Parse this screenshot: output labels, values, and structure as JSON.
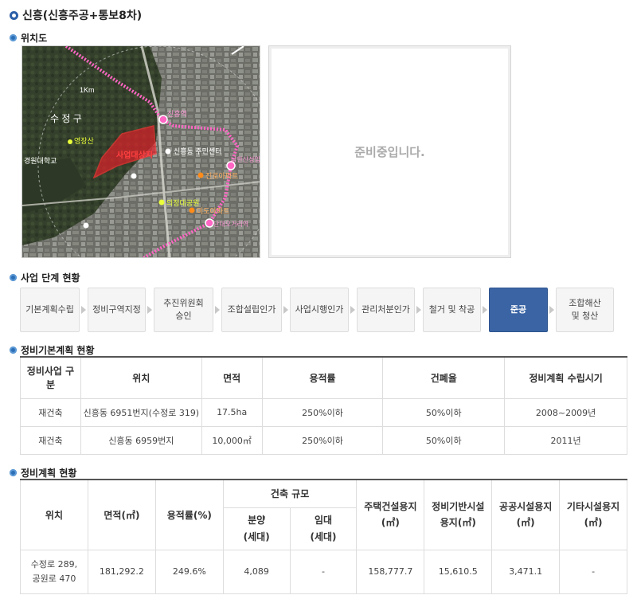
{
  "page_title": "신흥(신흥주공+통보8차)",
  "location": {
    "heading": "위치도",
    "placeholder_text": "준비중입니다.",
    "map_labels": [
      "1Km",
      "수 정 구",
      "영장산",
      "경원대학교",
      "신흥역",
      "신흥동 주민센터",
      "남한산성입구",
      "진로아파트",
      "의정대공원",
      "미도아파트",
      "단대오거리역",
      "사업대상지"
    ]
  },
  "stages": {
    "heading": "사업 단계 현황",
    "items": [
      {
        "label": "기본계획수립",
        "active": false
      },
      {
        "label": "정비구역지정",
        "active": false
      },
      {
        "label": "추진위원회 승인",
        "active": false
      },
      {
        "label": "조합설립인가",
        "active": false
      },
      {
        "label": "사업시행인가",
        "active": false
      },
      {
        "label": "관리처분인가",
        "active": false
      },
      {
        "label": "철거 및 착공",
        "active": false
      },
      {
        "label": "준공",
        "active": true
      },
      {
        "label": "조합해산 및 청산",
        "active": false
      }
    ]
  },
  "basic_plan": {
    "heading": "정비기본계획 현황",
    "headers": [
      "정비사업 구분",
      "위치",
      "면적",
      "용적률",
      "건폐율",
      "정비계획 수립시기"
    ],
    "rows": [
      [
        "재건축",
        "신흥동 6951번지(수정로 319)",
        "17.5ha",
        "250%이하",
        "50%이하",
        "2008~2009년"
      ],
      [
        "재건축",
        "신흥동 6959번지",
        "10,000㎡",
        "250%이하",
        "50%이하",
        "2011년"
      ]
    ]
  },
  "plan": {
    "heading": "정비계획 현황",
    "headers": {
      "location": "위치",
      "area": "면적(㎡)",
      "far": "용적률(%)",
      "scale": "건축 규모",
      "sale": "분양\n(세대)",
      "rent": "임대\n(세대)",
      "housing": "주택건설용지\n(㎡)",
      "infra": "정비기반시설\n용지(㎡)",
      "public": "공공시설용지\n(㎡)",
      "other": "기타시설용지\n(㎡)"
    },
    "row": {
      "location": "수정로 289, 공원로 470",
      "area": "181,292.2",
      "far": "249.6%",
      "sale": "4,089",
      "rent": "-",
      "housing": "158,777.7",
      "infra": "15,610.5",
      "public": "3,471.1",
      "other": "-"
    }
  },
  "colors": {
    "accent": "#3a64a4",
    "route": "#ff66c4",
    "site": "#e0202a"
  }
}
